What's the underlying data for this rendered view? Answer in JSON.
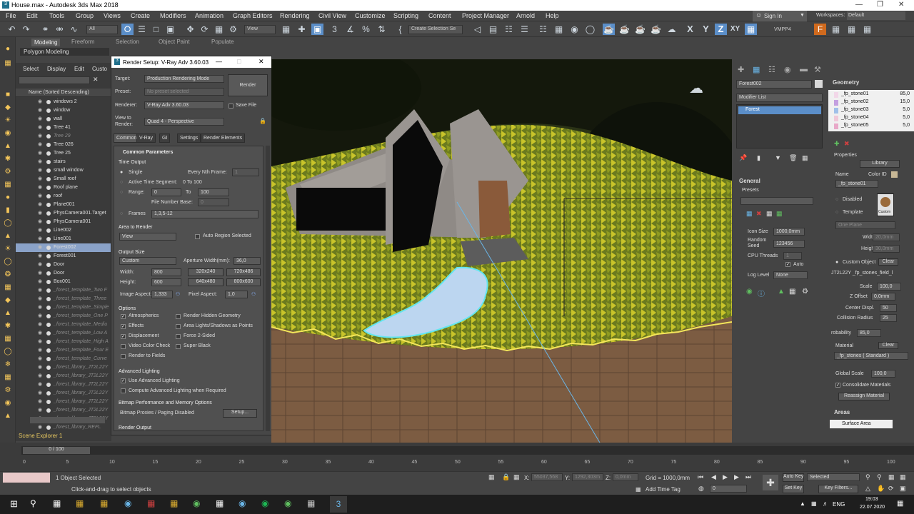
{
  "window": {
    "title": "House.max - Autodesk 3ds Max 2018"
  },
  "menu": [
    "File",
    "Edit",
    "Tools",
    "Group",
    "Views",
    "Create",
    "Modifiers",
    "Animation",
    "Graph Editors",
    "Rendering",
    "Civil View",
    "Customize",
    "Scripting",
    "Content",
    "Project Manager",
    "Arnold",
    "Help"
  ],
  "account": {
    "sign_in": "Sign In",
    "workspaces_label": "Workspaces:",
    "workspace": "Default"
  },
  "toolbar": {
    "filter": "All",
    "ref_coord": "View",
    "selection_set": "Create Selection Se",
    "axes": [
      "X",
      "Y",
      "Z",
      "XY"
    ],
    "label_vmpp": "VMPP4"
  },
  "ribbon": {
    "tabs": [
      "Modeling",
      "Freeform",
      "Selection",
      "Object Paint",
      "Populate"
    ],
    "sub": "Polygon Modeling"
  },
  "explorer": {
    "menu": [
      "Select",
      "Display",
      "Edit",
      "Custo"
    ],
    "header": "Name (Sorted Descending)",
    "rows": [
      {
        "name": "windows 2",
        "grey": false
      },
      {
        "name": "window",
        "grey": false
      },
      {
        "name": "wall",
        "grey": false
      },
      {
        "name": "Tree 41",
        "grey": false
      },
      {
        "name": "Tree 29",
        "grey": true
      },
      {
        "name": "Tree 026",
        "grey": false
      },
      {
        "name": "Tree 25",
        "grey": false
      },
      {
        "name": "stairs",
        "grey": false
      },
      {
        "name": "small window",
        "grey": false
      },
      {
        "name": "Small roof",
        "grey": false
      },
      {
        "name": "Roof plane",
        "grey": false
      },
      {
        "name": "roof",
        "grey": false
      },
      {
        "name": "Plane001",
        "grey": false
      },
      {
        "name": "PhysCamera001.Target",
        "grey": false
      },
      {
        "name": "PhysCamera001",
        "grey": false
      },
      {
        "name": "Line002",
        "grey": false
      },
      {
        "name": "Line001",
        "grey": false
      },
      {
        "name": "Forest002",
        "grey": false,
        "sel": true
      },
      {
        "name": "Forest001",
        "grey": false
      },
      {
        "name": "Door",
        "grey": false
      },
      {
        "name": "Door",
        "grey": false
      },
      {
        "name": "Box001",
        "grey": false
      },
      {
        "name": "_forest_template_Two F",
        "grey": true
      },
      {
        "name": "_forest_template_Three",
        "grey": true
      },
      {
        "name": "_forest_template_Simple",
        "grey": true
      },
      {
        "name": "_forest_template_One P",
        "grey": true
      },
      {
        "name": "_forest_template_Mediu",
        "grey": true
      },
      {
        "name": "_forest_template_Low A",
        "grey": true
      },
      {
        "name": "_forest_template_High A",
        "grey": true
      },
      {
        "name": "_forest_template_Four E",
        "grey": true
      },
      {
        "name": "_forest_template_Curve",
        "grey": true
      },
      {
        "name": "_forest_library_JT2L22Y",
        "grey": true
      },
      {
        "name": "_forest_library_JT2L22Y",
        "grey": true
      },
      {
        "name": "_forest_library_JT2L22Y",
        "grey": true
      },
      {
        "name": "_forest_library_JT2L22Y",
        "grey": true
      },
      {
        "name": "_forest_library_JT2L22Y",
        "grey": true
      },
      {
        "name": "_forest_library_JT2L22Y",
        "grey": true
      },
      {
        "name": "_forest_library_JT2L22Y",
        "grey": true
      },
      {
        "name": "_forest_library_REFL",
        "grey": true
      }
    ],
    "footer": "Scene Explorer 1"
  },
  "dialog": {
    "title": "Render Setup: V-Ray Adv 3.60.03",
    "target_label": "Target:",
    "target": "Production Rendering Mode",
    "preset_label": "Preset:",
    "preset": "No preset selected",
    "renderer_label": "Renderer:",
    "renderer": "V-Ray Adv 3.60.03",
    "save_file": "Save File",
    "view_label": "View to\nRender:",
    "view": "Quad 4 - Perspective",
    "render_button": "Render",
    "tabs": [
      "Common",
      "V-Ray",
      "GI",
      "Settings",
      "Render Elements"
    ],
    "common_params": "Common Parameters",
    "time_output": "Time Output",
    "single": "Single",
    "every_nth": "Every Nth Frame:",
    "every_nth_val": "1",
    "active_segment": "Active Time Segment:",
    "active_segment_val": "0 To 100",
    "range": "Range:",
    "range_from": "0",
    "range_to_label": "To",
    "range_to": "100",
    "file_number_base": "File Number Base:",
    "file_number_val": "0",
    "frames": "Frames",
    "frames_val": "1,3,5-12",
    "area_to_render": "Area to Render",
    "area_view": "View",
    "auto_region": "Auto Region Selected",
    "output_size": "Output Size",
    "custom": "Custom",
    "aperture_label": "Aperture Width(mm):",
    "aperture": "36,0",
    "width_label": "Width:",
    "width": "800",
    "height_label": "Height:",
    "height": "600",
    "presets": [
      "320x240",
      "720x486",
      "640x480",
      "800x600"
    ],
    "image_aspect_label": "Image Aspect:",
    "image_aspect": "1,333",
    "pixel_aspect_label": "Pixel Aspect:",
    "pixel_aspect": "1,0",
    "options": "Options",
    "opt_left": [
      "Atmospherics",
      "Effects",
      "Displacement",
      "Video Color Check",
      "Render to Fields"
    ],
    "opt_left_checked": [
      true,
      true,
      true,
      false,
      false
    ],
    "opt_right": [
      "Render Hidden Geometry",
      "Area Lights/Shadows as Points",
      "Force 2-Sided",
      "Super Black"
    ],
    "adv_lighting": "Advanced Lighting",
    "use_adv": "Use Advanced Lighting",
    "compute_adv": "Compute Advanced Lighting when Required",
    "bitmap_perf": "Bitmap Performance and Memory Options",
    "bitmap_proxies": "Bitmap Proxies / Paging Disabled",
    "setup": "Setup...",
    "render_output": "Render Output"
  },
  "modify": {
    "object": "Forest002",
    "modifier_list": "Modifier List",
    "stack_item": "Forest",
    "general": "General",
    "presets": "Presets",
    "icon_size_label": "Icon Size",
    "icon_size": "1000,0mm",
    "random_seed_label": "Random Seed",
    "random_seed": "123456",
    "cpu_threads_label": "CPU Threads",
    "cpu_threads": "1",
    "auto": "Auto",
    "log_level_label": "Log Level",
    "log_level": "None"
  },
  "geometry": {
    "title": "Geometry",
    "rows": [
      {
        "name": "_fp_stone01",
        "val": "85,0",
        "color": "#f2d7e8"
      },
      {
        "name": "_fp_stone02",
        "val": "15,0",
        "color": "#c4a0e0"
      },
      {
        "name": "_fp_stone03",
        "val": "5,0",
        "color": "#a0c0e8"
      },
      {
        "name": "_fp_stone04",
        "val": "5,0",
        "color": "#f0c8d8"
      },
      {
        "name": "_fp_stone05",
        "val": "5,0",
        "color": "#e8a8c8"
      }
    ],
    "properties": "Properties",
    "library": "Library",
    "name_label": "Name",
    "color_id": "Color ID",
    "name_val": "_fp_stone01",
    "disabled": "Disabled",
    "template": "Template",
    "custom": "Custom",
    "one_plane": "One Plane",
    "width_label": "Width",
    "width": "20,0mm",
    "height_label": "Height",
    "height": "30,0mm",
    "custom_object": "Custom Object",
    "clear": "Clear",
    "object_file": "JT2L22Y _fp_stones_field_l",
    "scale_label": "Scale",
    "scale": "100,0",
    "z_offset_label": "Z Offset",
    "z_offset": "0,0mm",
    "center_displ_label": "Center Displ.",
    "center_displ": "50",
    "collision_label": "Collision Radius",
    "collision": "25",
    "probability_label": "robability",
    "probability": "85,0",
    "material_label": "Material",
    "material": "_fp_stones  ( Standard )",
    "global_scale_label": "Global Scale",
    "global_scale": "100,0",
    "consolidate": "Consolidate Materials",
    "reassign": "Reassign Material",
    "areas": "Areas",
    "surface_area": "Surface Area"
  },
  "timeline": {
    "frame": "0 / 100",
    "ticks": [
      "0",
      "5",
      "10",
      "15",
      "20",
      "25",
      "30",
      "35",
      "40",
      "45",
      "50",
      "55",
      "60",
      "65",
      "70",
      "75",
      "80",
      "85",
      "90",
      "95",
      "100"
    ]
  },
  "status": {
    "selected": "1 Object Selected",
    "hint": "Click-and-drag to select objects",
    "x_label": "X:",
    "x": "55037,568",
    "y_label": "Y:",
    "y": "1292,303m",
    "z_label": "Z:",
    "z": "0,0mm",
    "grid": "Grid = 1000,0mm",
    "add_time_tag": "Add Time Tag",
    "auto_key": "Auto Key",
    "set_key": "Set Key",
    "selected_dd": "Selected",
    "key_filters": "Key Filters...",
    "frame": "0"
  },
  "taskbar": {
    "lang": "ENG",
    "time": "19:03",
    "date": "22.07.2020"
  }
}
